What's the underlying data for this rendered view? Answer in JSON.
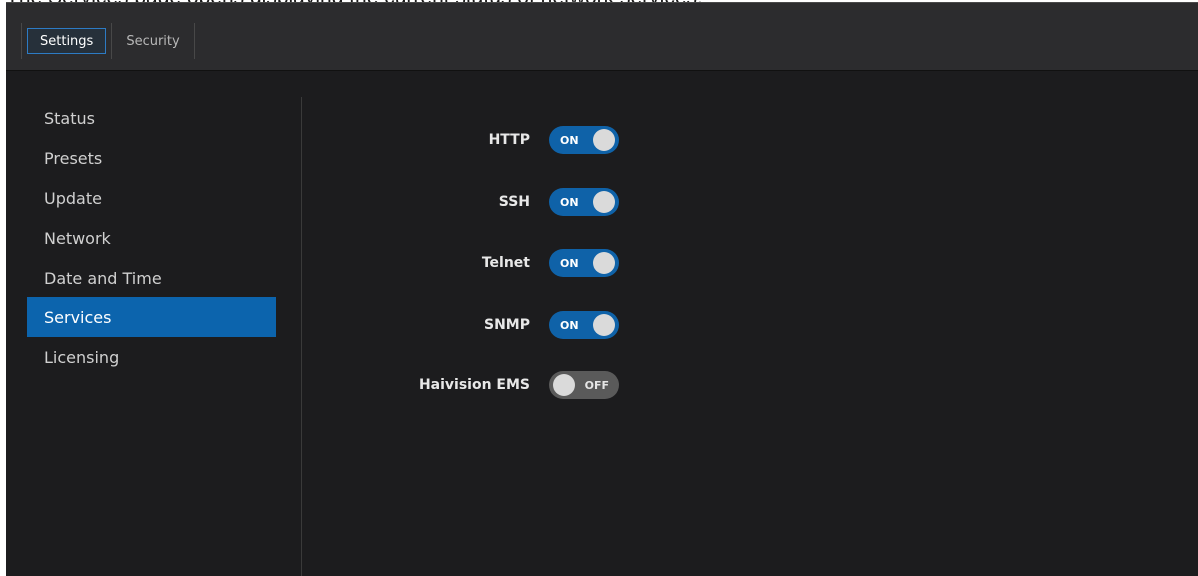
{
  "caption": "The Services page opens displaying the current status of network services.",
  "header": {
    "tabs": [
      {
        "label": "Settings",
        "active": true
      },
      {
        "label": "Security",
        "active": false
      }
    ]
  },
  "sidebar": {
    "items": [
      {
        "label": "Status"
      },
      {
        "label": "Presets"
      },
      {
        "label": "Update"
      },
      {
        "label": "Network"
      },
      {
        "label": "Date and Time"
      },
      {
        "label": "Services",
        "active": true
      },
      {
        "label": "Licensing"
      }
    ]
  },
  "services": [
    {
      "name": "HTTP",
      "state": "ON",
      "enabled": true
    },
    {
      "name": "SSH",
      "state": "ON",
      "enabled": true
    },
    {
      "name": "Telnet",
      "state": "ON",
      "enabled": true
    },
    {
      "name": "SNMP",
      "state": "ON",
      "enabled": true
    },
    {
      "name": "Haivision EMS",
      "state": "OFF",
      "enabled": false
    }
  ],
  "colors": {
    "accent": "#0c64ad",
    "toggle_on": "#0f62a8",
    "toggle_off": "#5a5a5a",
    "background": "#1c1c1e"
  }
}
